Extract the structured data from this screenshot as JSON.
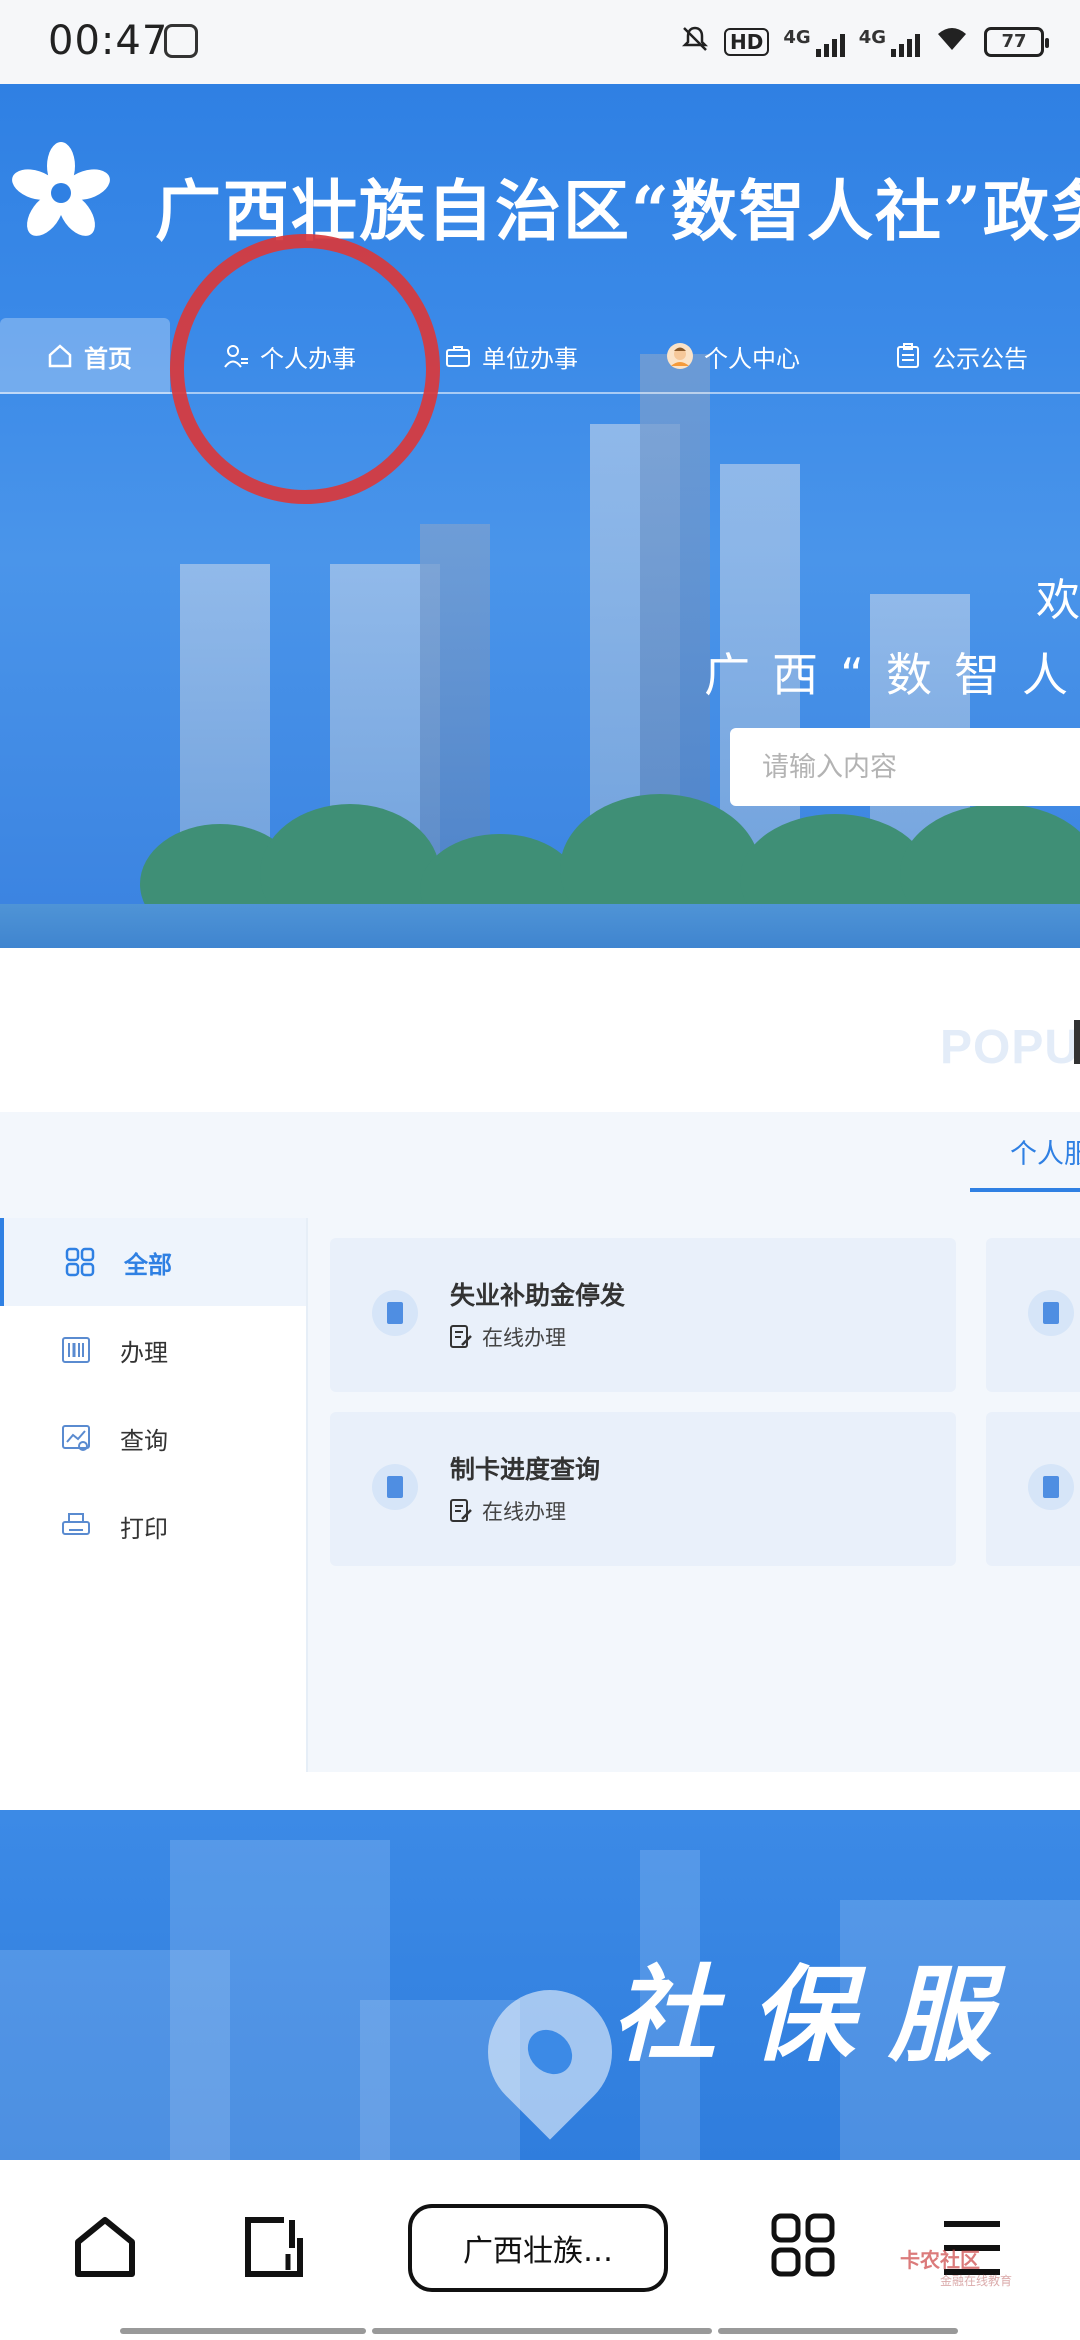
{
  "status_bar": {
    "time": "00:47",
    "network_hd": "HD",
    "network_1": "4G",
    "network_2": "4G",
    "battery": "77"
  },
  "header": {
    "site_title": "广西壮族自治区“数智人社”政务",
    "nav": [
      {
        "label": "首页",
        "icon": "home-icon"
      },
      {
        "label": "个人办事",
        "icon": "person-icon"
      },
      {
        "label": "单位办事",
        "icon": "briefcase-icon"
      },
      {
        "label": "个人中心",
        "icon": "avatar-icon"
      },
      {
        "label": "公示公告",
        "icon": "clipboard-icon"
      }
    ],
    "welcome_line1": "欢",
    "welcome_line2": "广西“数智人",
    "search_placeholder": "请输入内容"
  },
  "services": {
    "popular_label": "POPUL",
    "tab_label": "个人服",
    "sidebar": [
      {
        "label": "全部",
        "icon": "grid-icon"
      },
      {
        "label": "办理",
        "icon": "barcode-icon"
      },
      {
        "label": "查询",
        "icon": "chart-search-icon"
      },
      {
        "label": "打印",
        "icon": "printer-icon"
      }
    ],
    "cards": [
      {
        "title": "失业补助金停发",
        "subtitle": "在线办理"
      },
      {
        "title": "制卡进度查询",
        "subtitle": "在线办理"
      }
    ]
  },
  "banner": {
    "text": "社保服"
  },
  "bottom_nav": {
    "address": "广西壮族…",
    "watermark": "卡农社区",
    "watermark_sub": "金融在线教育"
  },
  "colors": {
    "brand_blue": "#2f80e3",
    "annotation_red": "#d9383b"
  }
}
